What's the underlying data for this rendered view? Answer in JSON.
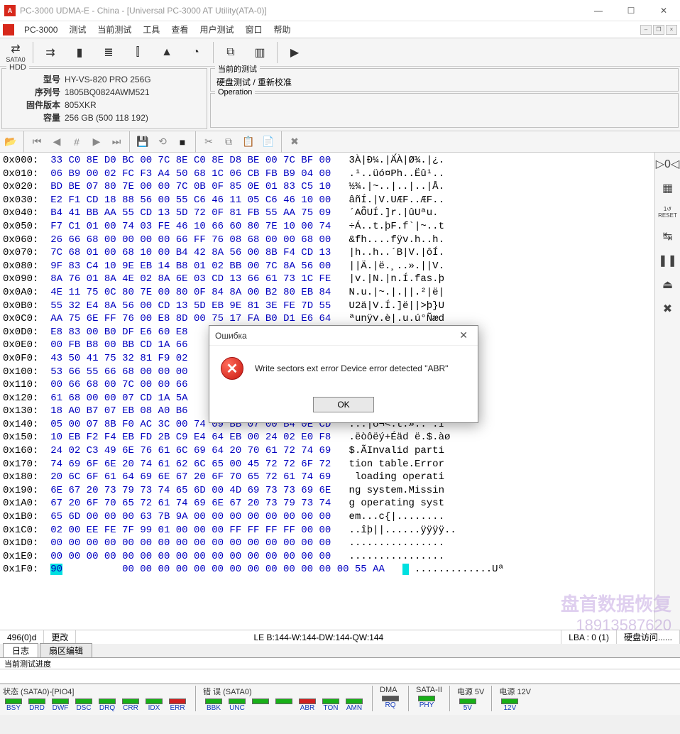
{
  "window": {
    "title": "PC-3000 UDMA-E - China - [Universal PC-3000 AT Utility(ATA-0)]",
    "app_short": "PC-3000"
  },
  "menu": [
    "测试",
    "当前测试",
    "工具",
    "查看",
    "用户测试",
    "窗口",
    "帮助"
  ],
  "toolbar1": {
    "sata0": "SATA0"
  },
  "hdd": {
    "legend": "HDD",
    "model_lbl": "型号",
    "model": "HY-VS-820 PRO 256G",
    "serial_lbl": "序列号",
    "serial": "1805BQ0824AWM521",
    "fw_lbl": "固件版本",
    "fw": "805XKR",
    "cap_lbl": "容量",
    "cap": "256 GB (500 118 192)"
  },
  "op": {
    "current_lbl": "当前的测试",
    "current_val": "硬盘测试 / 重新校准",
    "operation_lbl": "Operation"
  },
  "hex": {
    "rows": [
      {
        "a": "0x000:",
        "h": "33 C0 8E D0 BC 00 7C 8E C0 8E D8 BE 00 7C BF 00",
        "s": "3À|Đ¼.|Ä́À|Ø¾.|¿."
      },
      {
        "a": "0x010:",
        "h": "06 B9 00 02 FC F3 A4 50 68 1C 06 CB FB B9 04 00",
        "s": ".¹..üó¤Ph..Ëû¹.."
      },
      {
        "a": "0x020:",
        "h": "BD BE 07 80 7E 00 00 7C 0B 0F 85 0E 01 83 C5 10",
        "s": "½¾.|~..|..|..|Å."
      },
      {
        "a": "0x030:",
        "h": "E2 F1 CD 18 88 56 00 55 C6 46 11 05 C6 46 10 00",
        "s": "âñÍ.|V.UÆF..ÆF.."
      },
      {
        "a": "0x040:",
        "h": "B4 41 BB AA 55 CD 13 5D 72 0F 81 FB 55 AA 75 09",
        "s": "´AȪUÍ.]r.|ûUªu."
      },
      {
        "a": "0x050:",
        "h": "F7 C1 01 00 74 03 FE 46 10 66 60 80 7E 10 00 74",
        "s": "÷Á..t.þF.f`|~..t"
      },
      {
        "a": "0x060:",
        "h": "26 66 68 00 00 00 00 66 FF 76 08 68 00 00 68 00",
        "s": "&fh....fÿv.h..h."
      },
      {
        "a": "0x070:",
        "h": "7C 68 01 00 68 10 00 B4 42 8A 56 00 8B F4 CD 13",
        "s": "|h..h..´B|V.|ôÍ."
      },
      {
        "a": "0x080:",
        "h": "9F 83 C4 10 9E EB 14 B8 01 02 BB 00 7C 8A 56 00",
        "s": "||Ä.|ë.¸..».||V."
      },
      {
        "a": "0x090:",
        "h": "8A 76 01 8A 4E 02 8A 6E 03 CD 13 66 61 73 1C FE",
        "s": "|v.|N.|n.Í.fas.þ"
      },
      {
        "a": "0x0A0:",
        "h": "4E 11 75 0C 80 7E 00 80 0F 84 8A 00 B2 80 EB 84",
        "s": "N.u.|~.|.||.²|ë|"
      },
      {
        "a": "0x0B0:",
        "h": "55 32 E4 8A 56 00 CD 13 5D EB 9E 81 3E FE 7D 55",
        "s": "U2ä|V.Í.]ë||>þ}U"
      },
      {
        "a": "0x0C0:",
        "h": "AA 75 6E FF 76 00 E8 8D 00 75 17 FA B0 D1 E6 64",
        "s": "ªunÿv.è|.u.ú°Ñæd"
      },
      {
        "a": "0x0D0:",
        "h": "E8 83 00 B0 DF E6 60 E8                        ",
        "s": ""
      },
      {
        "a": "0x0E0:",
        "h": "00 FB B8 00 BB CD 1A 66                        ",
        "s": ""
      },
      {
        "a": "0x0F0:",
        "h": "43 50 41 75 32 81 F9 02                        ",
        "s": ""
      },
      {
        "a": "0x100:",
        "h": "53 66 55 66 68 00 00 00                        ",
        "s": ""
      },
      {
        "a": "0x110:",
        "h": "00 66 68 00 7C 00 00 66                        ",
        "s": ""
      },
      {
        "a": "0x120:",
        "h": "61 68 00 00 07 CD 1A 5A                        ",
        "s": ""
      },
      {
        "a": "0x130:",
        "h": "18 A0 B7 07 EB 08 A0 B6                        ",
        "s": ""
      },
      {
        "a": "0x140:",
        "h": "05 00 07 8B F0 AC 3C 00 74 09 BB 07 00 B4 0E CD",
        "s": "...|ð¬<.t.»..´.Í"
      },
      {
        "a": "0x150:",
        "h": "10 EB F2 F4 EB FD 2B C9 E4 64 EB 00 24 02 E0 F8",
        "s": ".ëòôëý+Éäd ë.$.àø"
      },
      {
        "a": "0x160:",
        "h": "24 02 C3 49 6E 76 61 6C 69 64 20 70 61 72 74 69",
        "s": "$.ÃInvalid parti"
      },
      {
        "a": "0x170:",
        "h": "74 69 6F 6E 20 74 61 62 6C 65 00 45 72 72 6F 72",
        "s": "tion table.Error"
      },
      {
        "a": "0x180:",
        "h": "20 6C 6F 61 64 69 6E 67 20 6F 70 65 72 61 74 69",
        "s": " loading operati"
      },
      {
        "a": "0x190:",
        "h": "6E 67 20 73 79 73 74 65 6D 00 4D 69 73 73 69 6E",
        "s": "ng system.Missin"
      },
      {
        "a": "0x1A0:",
        "h": "67 20 6F 70 65 72 61 74 69 6E 67 20 73 79 73 74",
        "s": "g operating syst"
      },
      {
        "a": "0x1B0:",
        "h": "65 6D 00 00 00 63 7B 9A 00 00 00 00 00 00 00 00",
        "s": "em...c{|........"
      },
      {
        "a": "0x1C0:",
        "h": "02 00 EE FE 7F 99 01 00 00 00 FF FF FF FF 00 00",
        "s": "..îþ||......ÿÿÿÿ.."
      },
      {
        "a": "0x1D0:",
        "h": "00 00 00 00 00 00 00 00 00 00 00 00 00 00 00 00",
        "s": "................"
      },
      {
        "a": "0x1E0:",
        "h": "00 00 00 00 00 00 00 00 00 00 00 00 00 00 00 00",
        "s": "................"
      },
      {
        "a": "0x1F0:",
        "h": "   00 00 00 00 00 00 00 00 00 00 00 00 00 55 AA",
        "s": " .............Uª",
        "hl_first": "90"
      }
    ]
  },
  "status": {
    "offset": "496(0)d",
    "changes": "更改",
    "le": "LE B:144-W:144-DW:144-QW:144",
    "lba": "LBA : 0 (1)",
    "access": "硬盘访问......"
  },
  "tabs": {
    "log": "日志",
    "sector": "扇区编辑"
  },
  "progress_lbl": "当前测试进度",
  "bottom": {
    "state_lbl": "状态 (SATA0)-[PIO4]",
    "state_leds": [
      {
        "l": "BSY",
        "c": "green"
      },
      {
        "l": "DRD",
        "c": "green"
      },
      {
        "l": "DWF",
        "c": "green"
      },
      {
        "l": "DSC",
        "c": "green"
      },
      {
        "l": "DRQ",
        "c": "green"
      },
      {
        "l": "CRR",
        "c": "green"
      },
      {
        "l": "IDX",
        "c": "green"
      },
      {
        "l": "ERR",
        "c": "red"
      }
    ],
    "err_lbl": "错 误 (SATA0)",
    "err_leds": [
      {
        "l": "BBK",
        "c": "green"
      },
      {
        "l": "UNC",
        "c": "green"
      },
      {
        "l": "",
        "c": "green"
      },
      {
        "l": "",
        "c": "green"
      },
      {
        "l": "ABR",
        "c": "red"
      },
      {
        "l": "TON",
        "c": "green"
      },
      {
        "l": "AMN",
        "c": "green"
      }
    ],
    "dma_lbl": "DMA",
    "dma_leds": [
      {
        "l": "RQ",
        "c": "off"
      }
    ],
    "sata2_lbl": "SATA-II",
    "sata2_leds": [
      {
        "l": "PHY",
        "c": "green"
      }
    ],
    "p5_lbl": "电源 5V",
    "p5_leds": [
      {
        "l": "5V",
        "c": "green"
      }
    ],
    "p12_lbl": "电源 12V",
    "p12_leds": [
      {
        "l": "12V",
        "c": "green"
      }
    ]
  },
  "dialog": {
    "title": "Ошибка",
    "msg": "Write sectors ext error Device error detected \"ABR\"",
    "ok": "OK"
  },
  "watermark": {
    "l1": "盘首数据恢复",
    "l2": "18913587620"
  }
}
